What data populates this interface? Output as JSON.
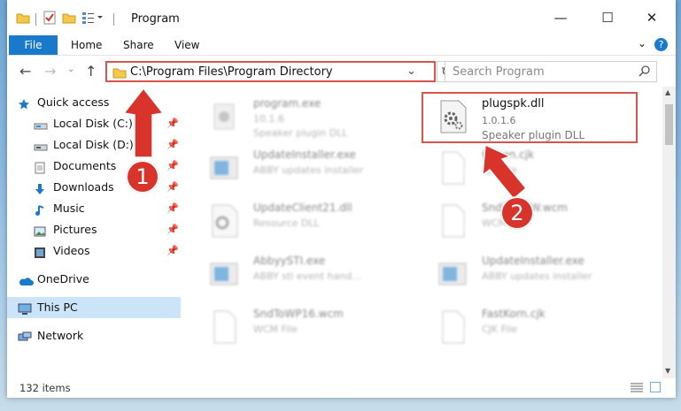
{
  "window": {
    "title": "Program",
    "minimize_glyph": "—",
    "maximize_glyph": "☐",
    "close_glyph": "✕"
  },
  "ribbon": {
    "tabs": [
      "File",
      "Home",
      "Share",
      "View"
    ]
  },
  "nav": {
    "back_glyph": "←",
    "forward_glyph": "→",
    "up_glyph": "↑",
    "help_glyph": "?"
  },
  "address": {
    "path": "C:\\Program Files\\Program Directory"
  },
  "search": {
    "placeholder": "Search Program"
  },
  "sidebar": {
    "items": [
      {
        "label": "Quick access",
        "icon": "star-icon"
      },
      {
        "label": "Local Disk (C:)",
        "icon": "drive-icon",
        "pinned": true
      },
      {
        "label": "Local Disk (D:)",
        "icon": "drive-icon",
        "pinned": true
      },
      {
        "label": "Documents",
        "icon": "documents-icon",
        "pinned": true
      },
      {
        "label": "Downloads",
        "icon": "download-icon",
        "pinned": true
      },
      {
        "label": "Music",
        "icon": "music-icon",
        "pinned": true
      },
      {
        "label": "Pictures",
        "icon": "pictures-icon",
        "pinned": true
      },
      {
        "label": "Videos",
        "icon": "videos-icon",
        "pinned": true
      },
      {
        "label": "OneDrive",
        "icon": "cloud-icon"
      },
      {
        "label": "This PC",
        "icon": "computer-icon",
        "selected": true
      },
      {
        "label": "Network",
        "icon": "network-icon"
      }
    ]
  },
  "files": [
    {
      "name": "program.exe",
      "line2": "10.1.6",
      "line3": "Speaker plugin DLL"
    },
    {
      "name": "plugspk.dll",
      "line2": "1.0.1.6",
      "line3": "Speaker plugin DLL"
    },
    {
      "name": "UpdateInstaller.exe",
      "line2": "ABBY updates installer"
    },
    {
      "name": "KBaen.cjk",
      "line2": "CJK File"
    },
    {
      "name": "UpdateClient21.dll",
      "line2": "Resource DLL"
    },
    {
      "name": "SndToWPW.wcm",
      "line2": "WCM File"
    },
    {
      "name": "AbbyySTI.exe",
      "line2": "ABBY sti event hand..."
    },
    {
      "name": "UpdateInstaller.exe",
      "line2": "ABBY updates installer"
    },
    {
      "name": "SndToWP16.wcm",
      "line2": "WCM File"
    },
    {
      "name": "FastKorn.cjk",
      "line2": "CJK File"
    }
  ],
  "status": {
    "items_count": "132 items"
  },
  "annotations": {
    "step1": "1",
    "step2": "2",
    "color": "#d9342b"
  }
}
